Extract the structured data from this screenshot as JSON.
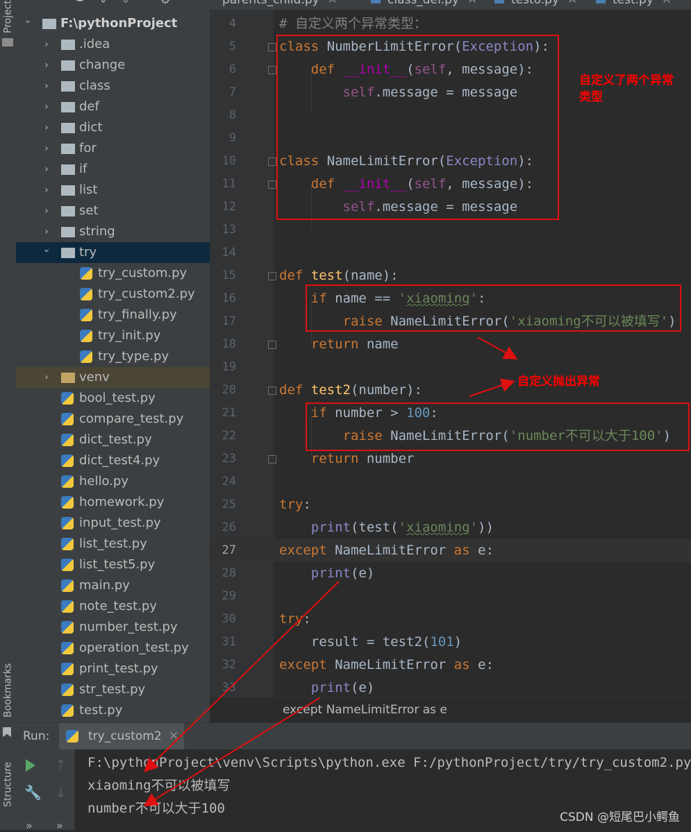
{
  "left_stripe": {
    "project_label": "Project",
    "bookmarks_label": "Bookmarks",
    "structure_label": "Structure"
  },
  "project_tree": {
    "root": "F:\\pythonProject",
    "rows": [
      {
        "label": "F:\\pythonProject",
        "type": "folder",
        "depth": 0,
        "expanded": true
      },
      {
        "label": ".idea",
        "type": "folder",
        "depth": 1,
        "expanded": false
      },
      {
        "label": "change",
        "type": "folder",
        "depth": 1,
        "expanded": false
      },
      {
        "label": "class",
        "type": "folder",
        "depth": 1,
        "expanded": false
      },
      {
        "label": "def",
        "type": "folder",
        "depth": 1,
        "expanded": false
      },
      {
        "label": "dict",
        "type": "folder",
        "depth": 1,
        "expanded": false
      },
      {
        "label": "for",
        "type": "folder",
        "depth": 1,
        "expanded": false
      },
      {
        "label": "if",
        "type": "folder",
        "depth": 1,
        "expanded": false
      },
      {
        "label": "list",
        "type": "folder",
        "depth": 1,
        "expanded": false
      },
      {
        "label": "set",
        "type": "folder",
        "depth": 1,
        "expanded": false
      },
      {
        "label": "string",
        "type": "folder",
        "depth": 1,
        "expanded": false
      },
      {
        "label": "try",
        "type": "folder",
        "depth": 1,
        "expanded": true,
        "selected": true
      },
      {
        "label": "try_custom.py",
        "type": "py",
        "depth": 2
      },
      {
        "label": "try_custom2.py",
        "type": "py",
        "depth": 2
      },
      {
        "label": "try_finally.py",
        "type": "py",
        "depth": 2
      },
      {
        "label": "try_init.py",
        "type": "py",
        "depth": 2
      },
      {
        "label": "try_type.py",
        "type": "py",
        "depth": 2
      },
      {
        "label": "venv",
        "type": "folder",
        "depth": 1,
        "expanded": false,
        "excluded": true
      },
      {
        "label": "bool_test.py",
        "type": "py",
        "depth": 1
      },
      {
        "label": "compare_test.py",
        "type": "py",
        "depth": 1
      },
      {
        "label": "dict_test.py",
        "type": "py",
        "depth": 1
      },
      {
        "label": "dict_test4.py",
        "type": "py",
        "depth": 1
      },
      {
        "label": "hello.py",
        "type": "py",
        "depth": 1
      },
      {
        "label": "homework.py",
        "type": "py",
        "depth": 1
      },
      {
        "label": "input_test.py",
        "type": "py",
        "depth": 1
      },
      {
        "label": "list_test.py",
        "type": "py",
        "depth": 1
      },
      {
        "label": "list_test5.py",
        "type": "py",
        "depth": 1
      },
      {
        "label": "main.py",
        "type": "py",
        "depth": 1
      },
      {
        "label": "note_test.py",
        "type": "py",
        "depth": 1
      },
      {
        "label": "number_test.py",
        "type": "py",
        "depth": 1
      },
      {
        "label": "operation_test.py",
        "type": "py",
        "depth": 1
      },
      {
        "label": "print_test.py",
        "type": "py",
        "depth": 1
      },
      {
        "label": "str_test.py",
        "type": "py",
        "depth": 1
      },
      {
        "label": "test.py",
        "type": "py",
        "depth": 1
      }
    ]
  },
  "tabs": [
    "parents_child.py",
    "class_def.py",
    "testo.py",
    "test.py"
  ],
  "editor": {
    "current_line": 27,
    "lines": [
      {
        "n": 4,
        "html": "<span class='cm'># 自定义两个异常类型：</span>"
      },
      {
        "n": 5,
        "html": "<span class='k'>class</span> NumberLimitError(<span class='bi'>Exception</span>):"
      },
      {
        "n": 6,
        "html": "    <span class='k'>def</span> <span class='ma'>__init__</span>(<span class='sf'>self</span>, message):"
      },
      {
        "n": 7,
        "html": "        <span class='sf'>self</span>.message = message"
      },
      {
        "n": 8,
        "html": ""
      },
      {
        "n": 9,
        "html": ""
      },
      {
        "n": 10,
        "html": "<span class='k'>class</span> NameLimitError(<span class='bi'>Exception</span>):"
      },
      {
        "n": 11,
        "html": "    <span class='k'>def</span> <span class='ma'>__init__</span>(<span class='sf'>self</span>, message):"
      },
      {
        "n": 12,
        "html": "        <span class='sf'>self</span>.message = message"
      },
      {
        "n": 13,
        "html": ""
      },
      {
        "n": 14,
        "html": ""
      },
      {
        "n": 15,
        "html": "<span class='k'>def</span> <span class='fn'>test</span>(name):"
      },
      {
        "n": 16,
        "html": "    <span class='k'>if</span> name == <span class='s'>'<span class='wavy'>xiaoming</span>'</span>:"
      },
      {
        "n": 17,
        "html": "        <span class='k'>raise</span> NameLimitError(<span class='s'>'xiaoming不可以被填写'</span>)"
      },
      {
        "n": 18,
        "html": "    <span class='k'>return</span> name"
      },
      {
        "n": 19,
        "html": ""
      },
      {
        "n": 20,
        "html": "<span class='k'>def</span> <span class='fn'>test2</span>(number):"
      },
      {
        "n": 21,
        "html": "    <span class='k'>if</span> number > <span class='n'>100</span>:"
      },
      {
        "n": 22,
        "html": "        <span class='k'>raise</span> NameLimitError(<span class='s'>'number不可以大于100'</span>)"
      },
      {
        "n": 23,
        "html": "    <span class='k'>return</span> number"
      },
      {
        "n": 24,
        "html": ""
      },
      {
        "n": 25,
        "html": "<span class='k'>try</span>:"
      },
      {
        "n": 26,
        "html": "    <span class='bi'>print</span>(test(<span class='s'>'<span class='wavy'>xiaoming</span>'</span>))"
      },
      {
        "n": 27,
        "html": "<span class='k'>except</span> NameLimitError <span class='k'>as</span> e:"
      },
      {
        "n": 28,
        "html": "    <span class='bi'>print</span>(e)"
      },
      {
        "n": 29,
        "html": ""
      },
      {
        "n": 30,
        "html": "<span class='k'>try</span>:"
      },
      {
        "n": 31,
        "html": "    result = test2(<span class='n'>101</span>)"
      },
      {
        "n": 32,
        "html": "<span class='k'>except</span> NameLimitError <span class='k'>as</span> e:"
      },
      {
        "n": 33,
        "html": "    <span class='bi'>print</span>(e)"
      }
    ]
  },
  "breadcrumb": "except NameLimitError as e",
  "run": {
    "label": "Run:",
    "tab": "try_custom2",
    "output": [
      "F:\\pythonProject\\venv\\Scripts\\python.exe F:/pythonProject/try/try_custom2.py",
      "xiaoming不可以被填写",
      "number不可以大于100"
    ]
  },
  "annotations": {
    "two_types": "自定义了两个异常类型",
    "raise_custom": "自定义抛出异常",
    "color": "#ff0000"
  },
  "watermark": "CSDN @短尾巴小鳄鱼"
}
